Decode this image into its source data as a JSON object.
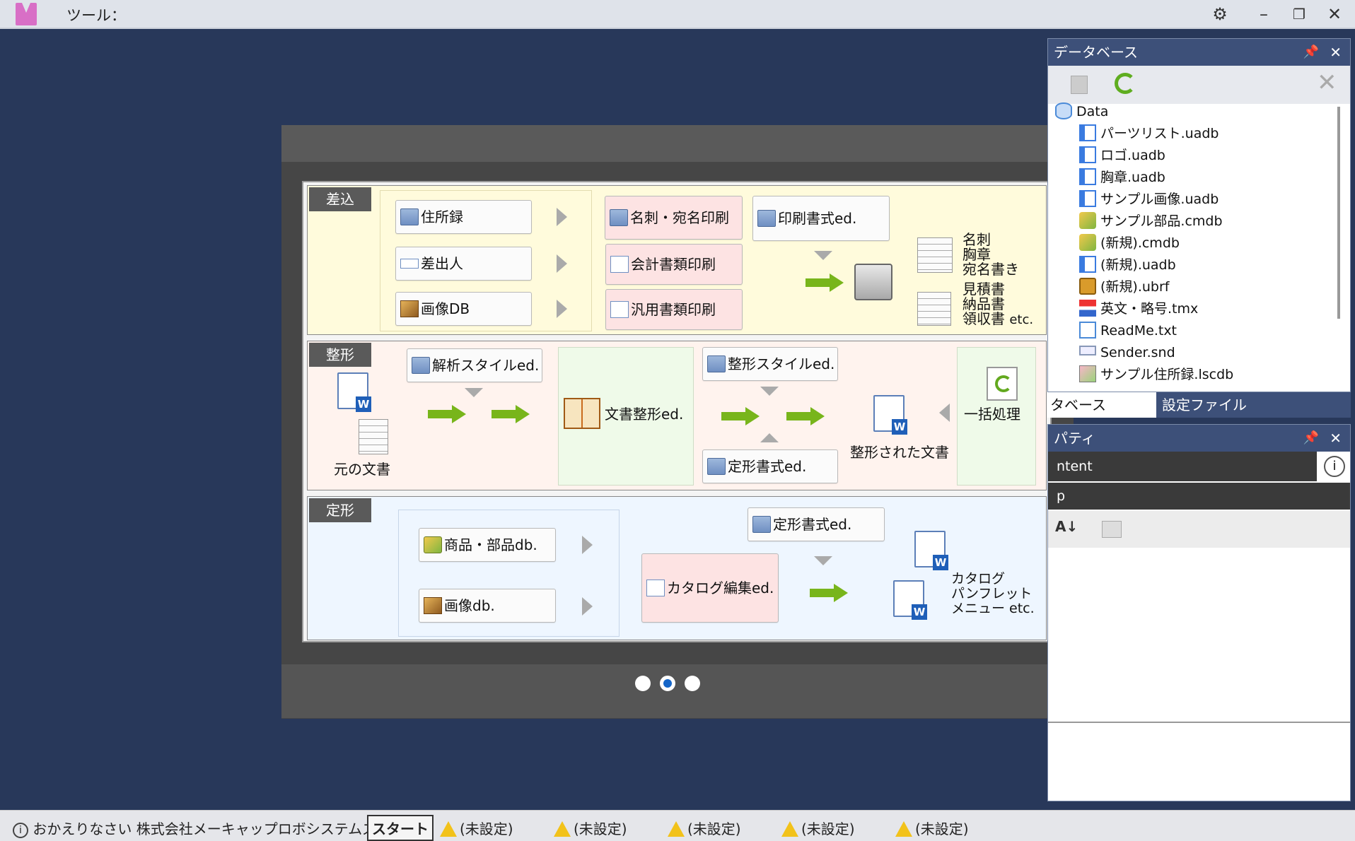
{
  "window": {
    "menu_tools": "ツール："
  },
  "slideshow": {
    "active_page": 2,
    "page_count": 3,
    "bands": {
      "merge": {
        "tag": "差込",
        "sources": [
          "住所録",
          "差出人",
          "画像DB"
        ],
        "actions": [
          "名刺・宛名印刷",
          "会計書類印刷",
          "汎用書類印刷"
        ],
        "editor": "印刷書式ed.",
        "out1_lines": [
          "名刺",
          "胸章",
          "宛名書き"
        ],
        "out2_lines": [
          "見積書",
          "納品書",
          "領収書"
        ],
        "out2_suffix": "etc."
      },
      "format": {
        "tag": "整形",
        "original_label": "元の文書",
        "parse_editor": "解析スタイルed.",
        "doc_editor": "文書整形ed.",
        "format_editor": "整形スタイルed.",
        "fixed_editor": "定形書式ed.",
        "result_label": "整形された文書",
        "batch_label": "一括処理"
      },
      "fixed": {
        "tag": "定形",
        "sources": [
          "商品・部品db.",
          "画像db."
        ],
        "catalog_editor": "カタログ編集ed.",
        "fixed_editor": "定形書式ed.",
        "out_lines": [
          "カタログ",
          "パンフレット",
          "メニュー etc."
        ]
      }
    }
  },
  "database_panel": {
    "title": "データベース",
    "root": "Data",
    "items": [
      {
        "label": "パーツリスト.uadb",
        "icon": "uadb-icon"
      },
      {
        "label": "ロゴ.uadb",
        "icon": "uadb-icon"
      },
      {
        "label": "胸章.uadb",
        "icon": "uadb-icon"
      },
      {
        "label": "サンプル画像.uadb",
        "icon": "uadb-icon"
      },
      {
        "label": "サンプル部品.cmdb",
        "icon": "cmdb-icon"
      },
      {
        "label": "(新規).cmdb",
        "icon": "cmdb-icon"
      },
      {
        "label": "(新規).uadb",
        "icon": "uadb-icon"
      },
      {
        "label": "(新規).ubrf",
        "icon": "ubrf-icon"
      },
      {
        "label": "英文・略号.tmx",
        "icon": "tmx-icon"
      },
      {
        "label": "ReadMe.txt",
        "icon": "txt-icon"
      },
      {
        "label": "Sender.snd",
        "icon": "snd-icon"
      },
      {
        "label": "サンプル住所録.lscdb",
        "icon": "lscdb-icon"
      }
    ],
    "tab_database": "タベース",
    "tab_settings": "設定ファイル"
  },
  "property_panel": {
    "title": "パティ",
    "content_field": "ntent",
    "sub_field": "p"
  },
  "status_bar": {
    "welcome": "おかえりなさい 株式会社メーキャップロボシステムズさん",
    "start": "スタート",
    "unset": [
      "(未設定)",
      "(未設定)",
      "(未設定)",
      "(未設定)",
      "(未設定)"
    ]
  },
  "colors": {
    "workspace": "#28385a",
    "merge_band": "#fffbdc",
    "format_band": "#fff3ee",
    "fixed_band": "#eef6ff",
    "pink_button": "#fde3e3",
    "arrow_green": "#78b51b",
    "active_dot": "#1566c9"
  }
}
